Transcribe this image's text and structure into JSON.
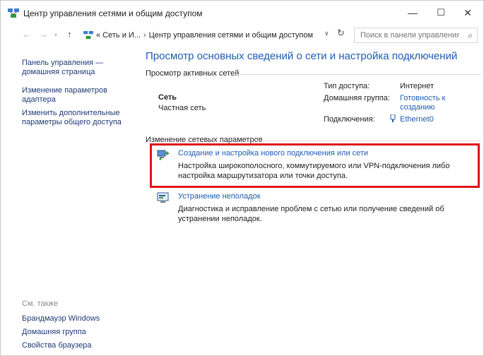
{
  "window": {
    "title": "Центр управления сетями и общим доступом",
    "minimize_glyph": "—",
    "maximize_glyph": "☐",
    "close_glyph": "✕"
  },
  "address_bar": {
    "crumb_root": "« Сеть и И...",
    "crumb_current": "Центр управления сетями и общим доступом",
    "search_placeholder": "Поиск в панели управления"
  },
  "left_pane": {
    "links": [
      "Панель управления — домашняя страница",
      "Изменение параметров адаптера",
      "Изменить дополнительные параметры общего доступа"
    ],
    "see_also_label": "См. также",
    "see_also_links": [
      "Брандмауэр Windows",
      "Домашняя группа",
      "Свойства браузера"
    ]
  },
  "main": {
    "heading": "Просмотр основных сведений о сети и настройка подключений",
    "active_networks_label": "Просмотр активных сетей",
    "network": {
      "name": "Сеть",
      "type": "Частная сеть",
      "access_type_label": "Тип доступа:",
      "access_type_value": "Интернет",
      "homegroup_label": "Домашняя группа:",
      "homegroup_value": "Готовность к созданию",
      "connections_label": "Подключения:",
      "connections_value": "Ethernet0"
    },
    "change_settings_label": "Изменение сетевых параметров",
    "tasks": [
      {
        "icon": "new-connection-icon",
        "title": "Создание и настройка нового подключения или сети",
        "desc": "Настройка широкополосного, коммутируемого или VPN-подключения либо настройка маршрутизатора или точки доступа."
      },
      {
        "icon": "troubleshoot-icon",
        "title": "Устранение неполадок",
        "desc": "Диагностика и исправление проблем с сетью или получение сведений об устранении неполадок."
      }
    ]
  },
  "colors": {
    "link": "#1e5cb3",
    "nav_link": "#1f3a78",
    "highlight": "#e0121a"
  }
}
